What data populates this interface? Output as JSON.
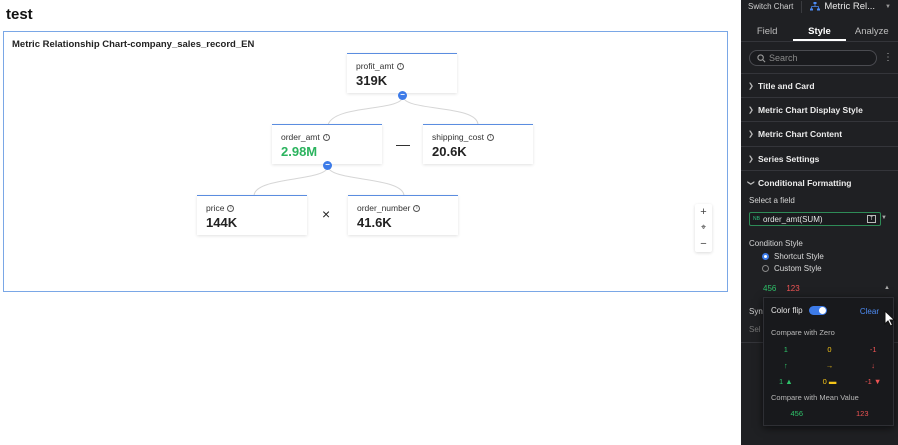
{
  "page": {
    "title": "test"
  },
  "chart": {
    "title": "Metric Relationship Chart-company_sales_record_EN",
    "nodes": {
      "profit": {
        "label": "profit_amt",
        "value": "319K"
      },
      "order": {
        "label": "order_amt",
        "value": "2.98M"
      },
      "shipping": {
        "label": "shipping_cost",
        "value": "20.6K"
      },
      "price": {
        "label": "price",
        "value": "144K"
      },
      "order_number": {
        "label": "order_number",
        "value": "41.6K"
      }
    },
    "operators": {
      "minus": "—",
      "times": "×"
    },
    "collapse_symbol": "−",
    "zoom": {
      "plus": "+",
      "fit": "⌖",
      "minus": "−"
    }
  },
  "panel": {
    "switch_label": "Switch Chart",
    "chart_type": "Metric Rel...",
    "tabs": [
      "Field",
      "Style",
      "Analyze"
    ],
    "search_placeholder": "Search",
    "kebab": "⋮",
    "sections": [
      "Title and Card",
      "Metric Chart Display Style",
      "Metric Chart Content",
      "Series Settings",
      "Conditional Formatting"
    ],
    "select_field_label": "Select a field",
    "field_tag": "NB",
    "field_value": "order_amt(SUM)",
    "field_badge": "T",
    "condition_style_label": "Condition Style",
    "radio_options": [
      "Shortcut Style",
      "Custom Style"
    ],
    "preview": {
      "positive": "456",
      "negative": "123"
    },
    "cut_label_1": "Syn",
    "cut_label_2": "Sel"
  },
  "popover": {
    "color_flip_label": "Color flip",
    "clear_label": "Clear",
    "compare_zero_title": "Compare with Zero",
    "zero_numbers": [
      "1",
      "0",
      "-1"
    ],
    "zero_arrows": [
      "↑",
      "→",
      "↓"
    ],
    "zero_combo": [
      "1 ▲",
      "0 ▬",
      "-1 ▼"
    ],
    "compare_mean_title": "Compare with Mean Value",
    "mean_values": [
      "456",
      "123"
    ]
  },
  "colors": {
    "positive": "#2fc26a",
    "neutral": "#f5c518",
    "negative": "#f05454",
    "accent": "#3d7be8"
  }
}
